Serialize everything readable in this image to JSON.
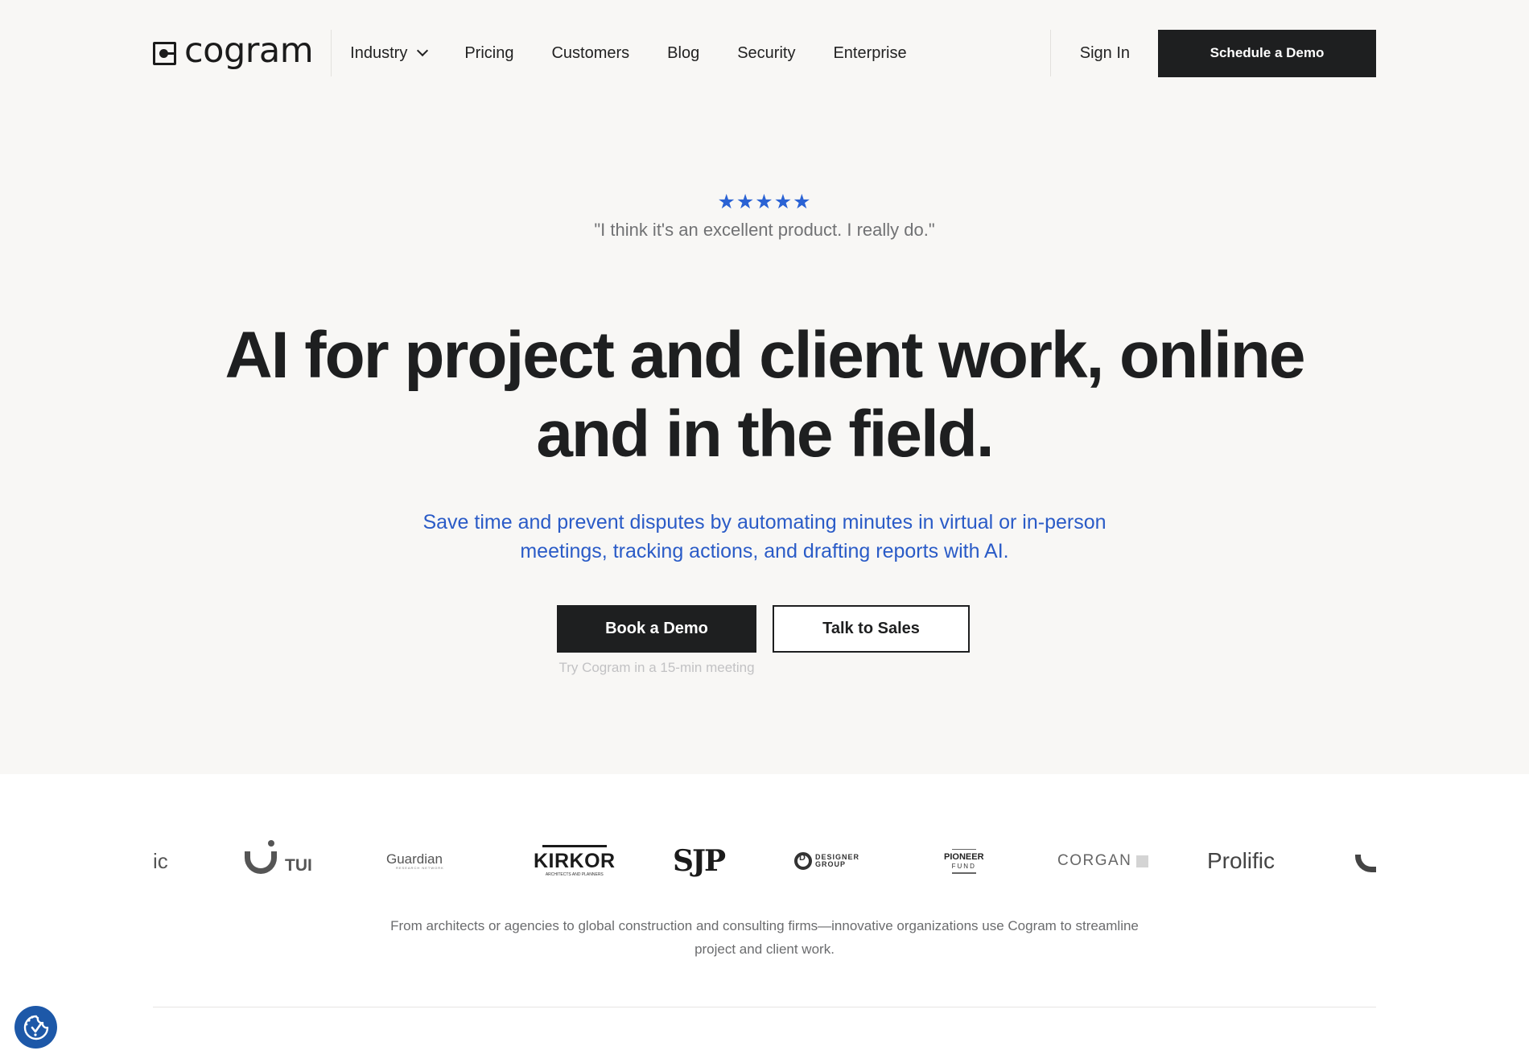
{
  "nav": {
    "logo_text": "cogram",
    "links": [
      {
        "label": "Industry",
        "has_dropdown": true
      },
      {
        "label": "Pricing"
      },
      {
        "label": "Customers"
      },
      {
        "label": "Blog"
      },
      {
        "label": "Security"
      },
      {
        "label": "Enterprise"
      }
    ],
    "sign_in": "Sign In",
    "cta": "Schedule a Demo"
  },
  "hero": {
    "rating": {
      "stars": 5,
      "max": 5,
      "glyphs": "★★★★★"
    },
    "quote": "\"I think it's an excellent product. I really do.\"",
    "headline_line1": "AI for project and client work, online",
    "headline_line2": "and in the field.",
    "subheadline": "Save time and prevent disputes by automating minutes in virtual or in-person meetings, tracking actions, and drafting reports with AI.",
    "primary_cta": "Book a Demo",
    "secondary_cta": "Talk to Sales",
    "cta_note": "Try Cogram in a 15-min meeting"
  },
  "logos": {
    "items": [
      {
        "name": "Prolific (partial)",
        "text": "ic"
      },
      {
        "name": "TUI",
        "text": "TUI"
      },
      {
        "name": "Guardian Research Network",
        "text": "Guardian",
        "sub": "RESEARCH NETWORK"
      },
      {
        "name": "Kirkor Architects and Planners",
        "text": "KIRKOR",
        "sub": "ARCHITECTS AND PLANNERS"
      },
      {
        "name": "SJP",
        "text": "SJP"
      },
      {
        "name": "Designer Group",
        "text": "DESIGNER",
        "text2": "GROUP"
      },
      {
        "name": "Pioneer Fund",
        "text": "PIONEER",
        "sub": "FUND"
      },
      {
        "name": "Corgan",
        "text": "CORGAN"
      },
      {
        "name": "Prolific",
        "text": "Prolific"
      },
      {
        "name": "TUI (partial)",
        "text": ""
      }
    ],
    "caption": "From architects or agencies to global construction and consulting firms—innovative organizations use Cogram to streamline project and client work."
  },
  "colors": {
    "accent_blue": "#2a62d4",
    "subhead_blue": "#2a5bc7",
    "dark": "#1e1f20",
    "hero_bg": "#f8f7f5",
    "cookie_blue": "#1d58a8"
  },
  "cookie_widget": {
    "icon": "cookie-consent-icon"
  }
}
